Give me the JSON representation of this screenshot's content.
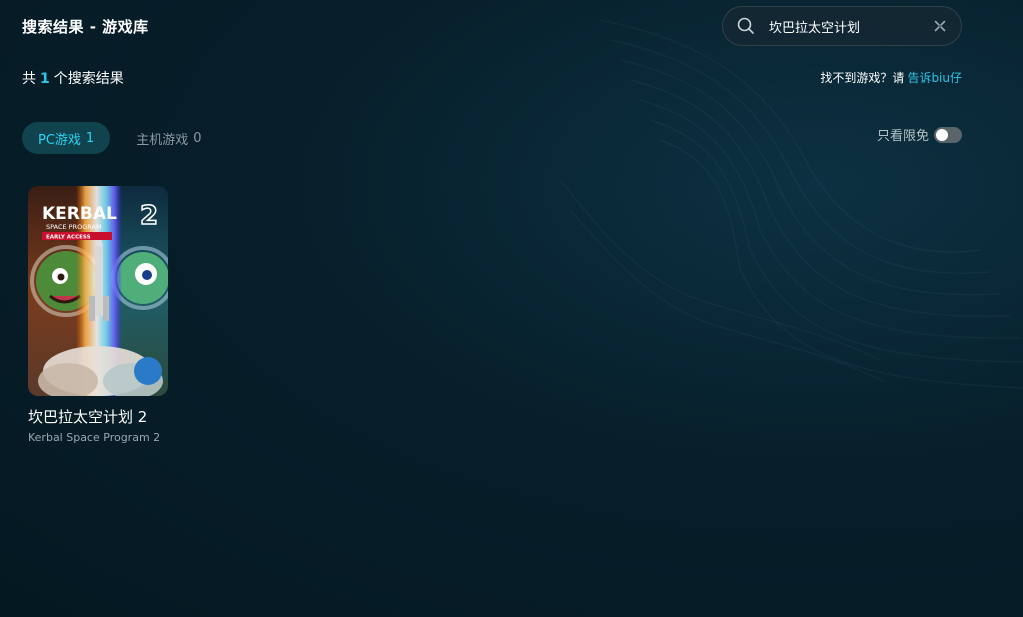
{
  "header": {
    "title": "搜索结果 - 游戏库"
  },
  "search": {
    "value": "坎巴拉太空计划",
    "icon": "search-icon",
    "clear_icon": "clear-icon"
  },
  "results": {
    "prefix": "共",
    "count": "1",
    "suffix": "个搜索结果"
  },
  "feedback": {
    "text": "找不到游戏？请",
    "link": "告诉biu仔"
  },
  "tabs": [
    {
      "label": "PC游戏",
      "count": "1",
      "active": true
    },
    {
      "label": "主机游戏",
      "count": "0",
      "active": false
    }
  ],
  "filter": {
    "label": "只看限免",
    "enabled": false
  },
  "games": [
    {
      "title_cn": "坎巴拉太空计划 2",
      "title_en": "Kerbal Space Program 2",
      "cover": {
        "logo_main": "KERBAL",
        "logo_num": "2",
        "logo_sub": "SPACE PROGRAM",
        "badge": "EARLY ACCESS"
      }
    }
  ],
  "colors": {
    "accent": "#29c9e8",
    "background": "#071f2b",
    "tab_active_bg": "#11434f"
  }
}
